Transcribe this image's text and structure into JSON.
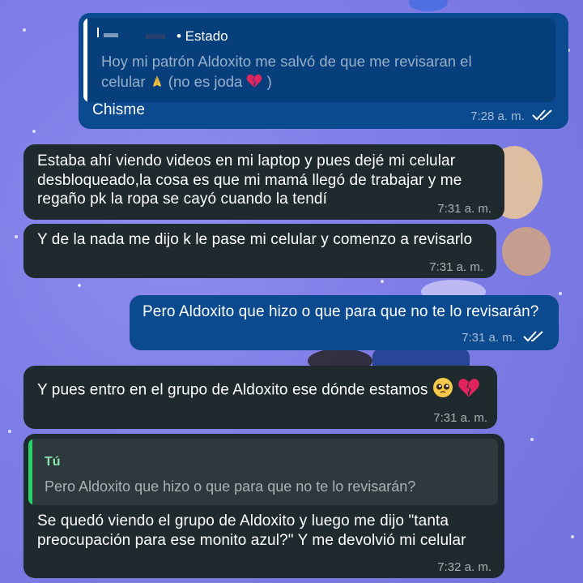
{
  "chat": {
    "messages": [
      {
        "direction": "outgoing",
        "quote": {
          "author": "• Estado",
          "text_line1": "Hoy mi patrón Aldoxito me salvó de que me revisaran el",
          "text_line2": "celular",
          "text_line2_end": "(no es joda",
          "text_line2_close": ")"
        },
        "text": "Chisme",
        "time": "7:28 a. m.",
        "status": "read"
      },
      {
        "direction": "incoming",
        "lines": [
          "Estaba ahí viendo videos en mi laptop y pues dejé mi celular",
          "desbloqueado,la cosa es que mi mamá llegó de trabajar y me",
          "regaño pk la ropa se cayó cuando la tendí"
        ],
        "time": "7:31 a. m."
      },
      {
        "direction": "incoming",
        "text": "Y de la nada me dijo k le pase mi celular y comenzo a revisarlo",
        "time": "7:31 a. m."
      },
      {
        "direction": "outgoing",
        "text": "Pero Aldoxito que hizo o que para que no te lo revisarán?",
        "time": "7:31 a. m.",
        "status": "read"
      },
      {
        "direction": "incoming",
        "text": "Y pues entro en el grupo de Aldoxito ese dónde estamos",
        "time": "7:31 a. m."
      },
      {
        "direction": "incoming",
        "quote": {
          "author": "Tú",
          "text": "Pero Aldoxito que hizo o que para que no te lo revisarán?"
        },
        "lines": [
          "Se quedó viendo el grupo de Aldoxito y luego me dijo \"tanta",
          "preocupación para ese monito azul?\" Y me devolvió mi celular"
        ],
        "time": "7:32 a. m."
      }
    ]
  },
  "colors": {
    "outgoing_bubble": "#0b4a8f",
    "incoming_bubble": "#1f2a2e",
    "quote_bar_status": "#ffffff",
    "quote_bar_you": "#25d366",
    "author_you": "#8fe3b0",
    "read_ticks": "#ffffff"
  },
  "icons": {
    "read_receipt": "double-check-icon",
    "prayer": "folded-hands-emoji",
    "broken_heart": "broken-heart-emoji",
    "pleading": "pleading-face-emoji"
  }
}
